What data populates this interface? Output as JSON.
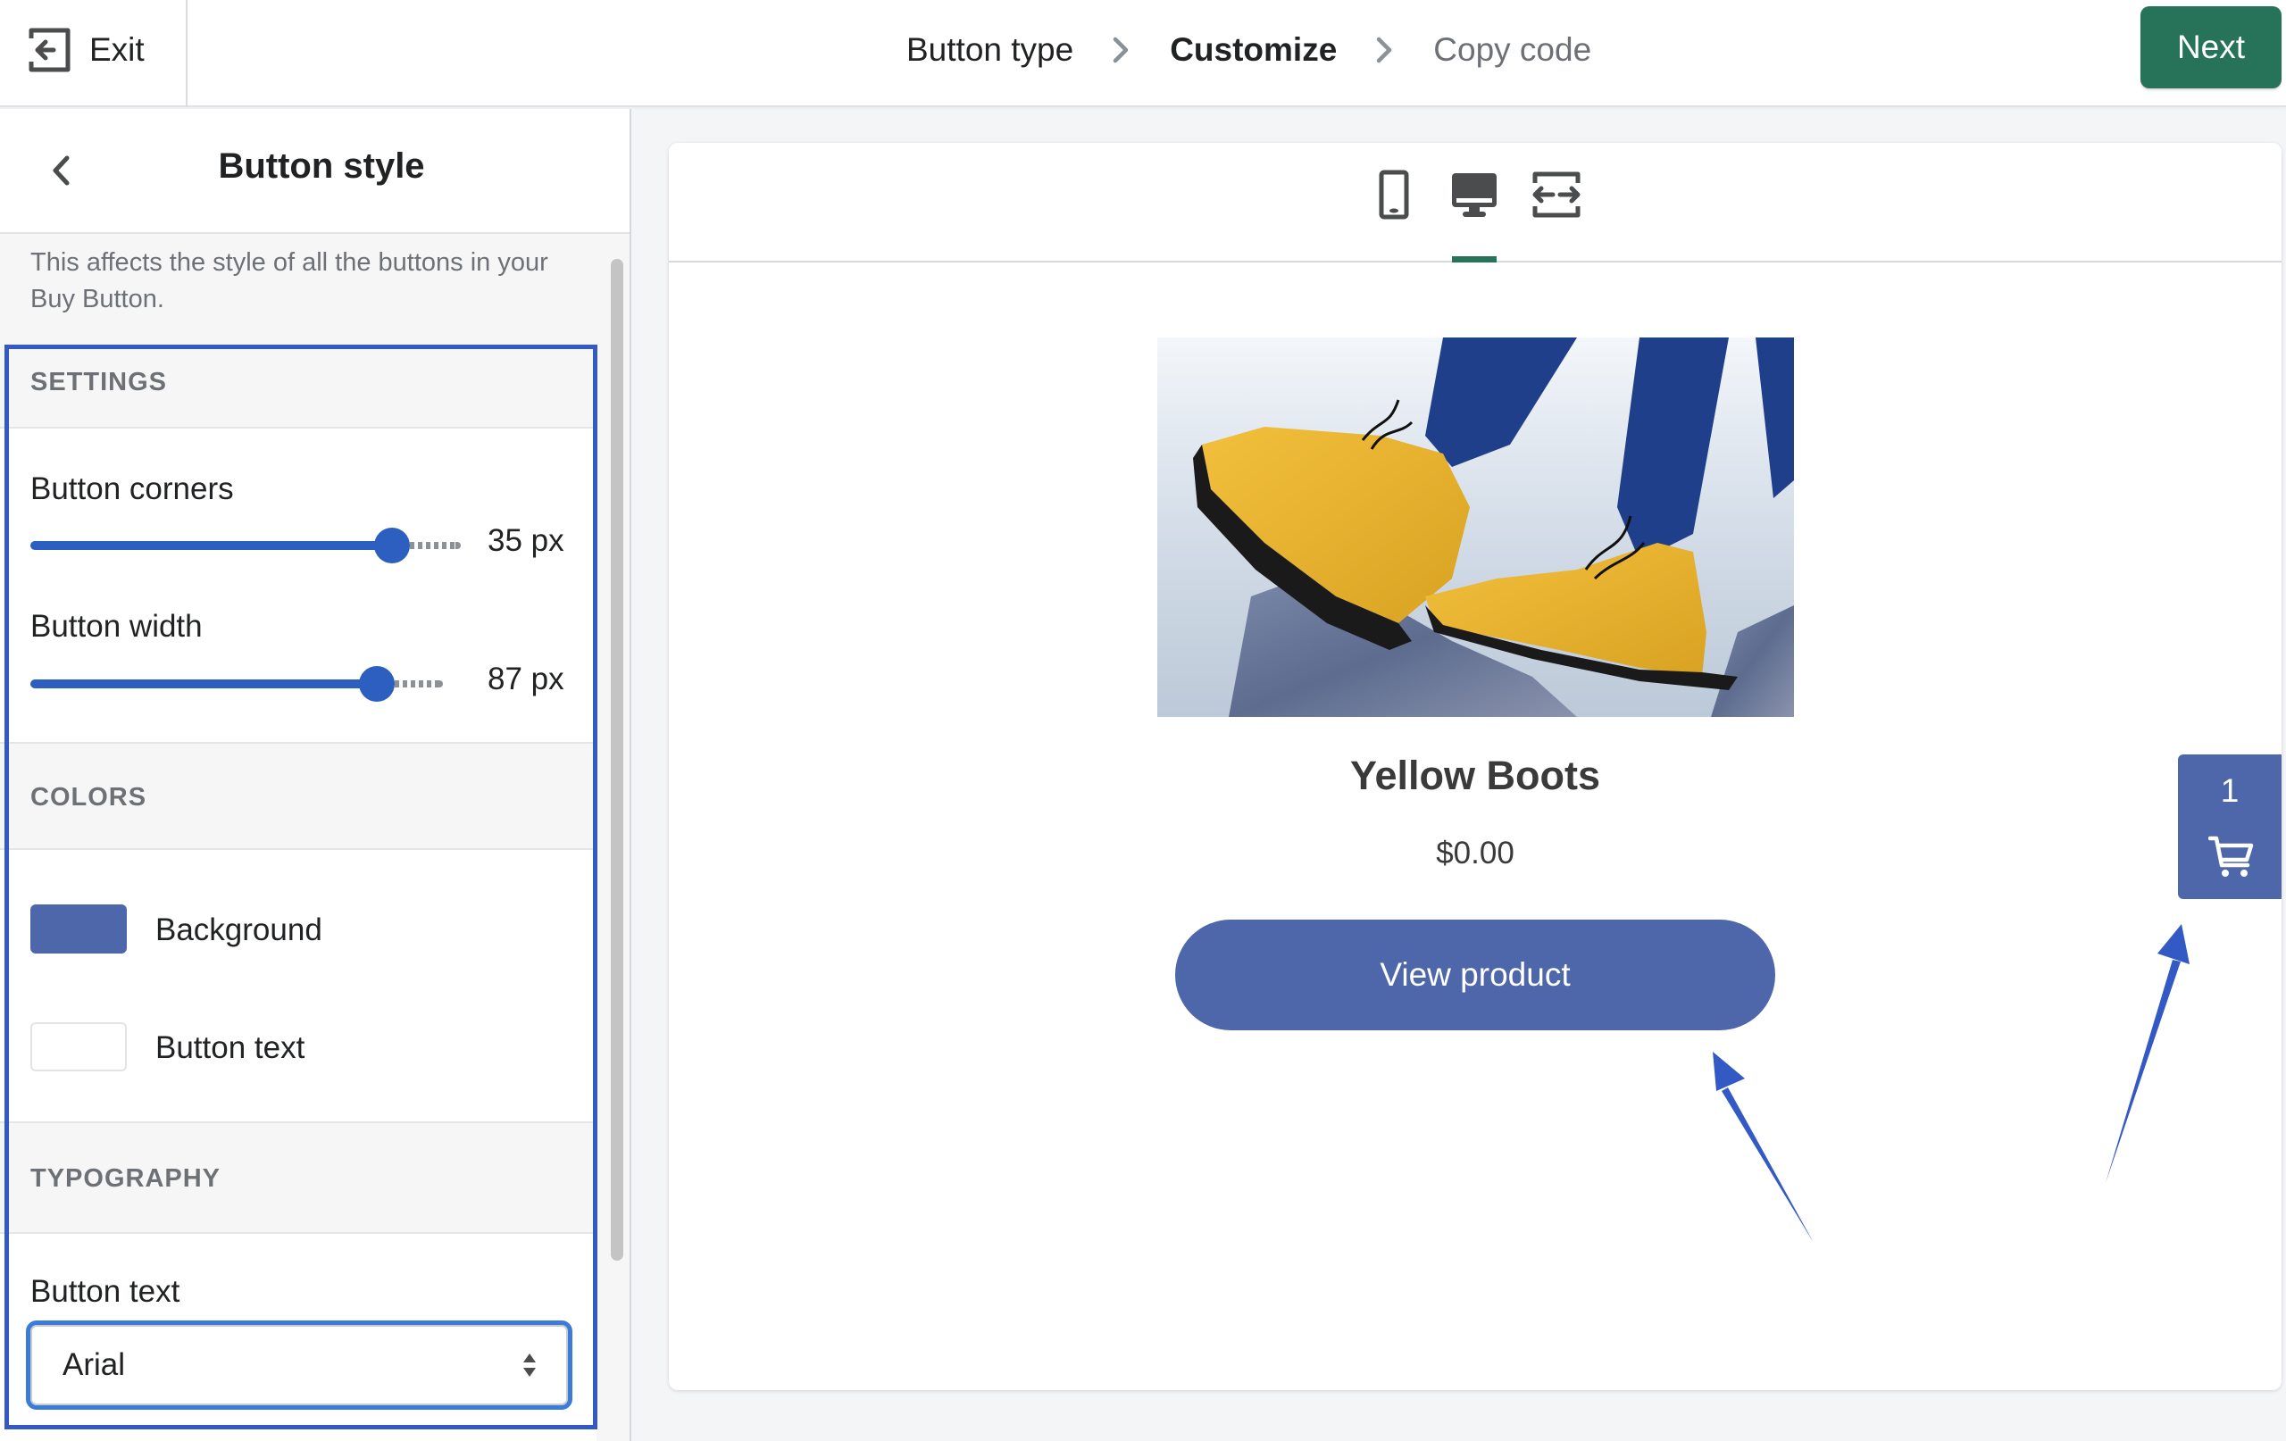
{
  "topbar": {
    "exit_label": "Exit",
    "breadcrumb": [
      {
        "label": "Button type",
        "state": "done"
      },
      {
        "label": "Customize",
        "state": "current"
      },
      {
        "label": "Copy code",
        "state": "upcoming"
      }
    ],
    "next_label": "Next"
  },
  "panel": {
    "title": "Button style",
    "description": "This affects the style of all the buttons in your Buy Button.",
    "sections": {
      "settings": {
        "heading": "SETTINGS",
        "corners": {
          "label": "Button corners",
          "value_label": "35 px",
          "fill_fraction": 0.84
        },
        "width": {
          "label": "Button width",
          "value_label": "87 px",
          "fill_fraction": 0.84
        }
      },
      "colors": {
        "heading": "COLORS",
        "background": {
          "label": "Background",
          "color": "#4e67aa"
        },
        "button_text": {
          "label": "Button text",
          "color": "#ffffff"
        }
      },
      "typography": {
        "heading": "TYPOGRAPHY",
        "button_text_label": "Button text",
        "font_value": "Arial"
      }
    }
  },
  "preview": {
    "device_tabs": [
      {
        "name": "mobile",
        "active": false
      },
      {
        "name": "desktop",
        "active": true
      },
      {
        "name": "fluid-width",
        "active": false
      }
    ],
    "product": {
      "title": "Yellow Boots",
      "price": "$0.00",
      "button_label": "View product",
      "image_alt": "Yellow boots on rocks"
    },
    "cart": {
      "count": "1"
    }
  },
  "colors": {
    "accent_green": "#27735a",
    "button_blue": "#4e67aa",
    "slider_blue": "#2c5fbf",
    "highlight_blue": "#3259c4"
  }
}
